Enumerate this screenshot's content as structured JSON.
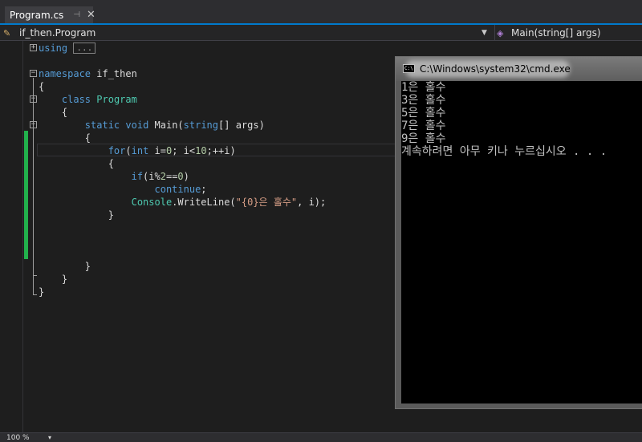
{
  "tab": {
    "title": "Program.cs",
    "pin_glyph": "⊣",
    "close_glyph": "✕"
  },
  "nav": {
    "left_label": "if_then.Program",
    "left_icon": "class-icon",
    "right_label": "Main(string[] args)",
    "right_icon": "method-icon"
  },
  "code": {
    "using_kw": "using",
    "using_collapsed": "...",
    "namespace_kw": "namespace",
    "namespace_name": " if_then",
    "class_kw": "class",
    "class_name": "Program",
    "static_kw": "static",
    "void_kw": "void",
    "main_name": " Main(",
    "string_kw": "string",
    "args_text": "[] args)",
    "for_kw": "for",
    "for_open": "(",
    "int_kw": "int",
    "for_init": " i=",
    "zero": "0",
    "for_cond": "; i<",
    "ten": "10",
    "for_inc": ";++i)",
    "if_kw": "if",
    "if_cond_pre": "(i%",
    "two": "2",
    "if_cond_mid": "==",
    "if_cond_zero": "0",
    "close_paren": ")",
    "continue_kw": "continue",
    "semicolon": ";",
    "console_type": "Console",
    "writeline_call": ".WriteLine(",
    "format_string": "\"{0}은 홀수\"",
    "writeline_args": ", i);",
    "open_brace": "{",
    "close_brace": "}"
  },
  "status": {
    "zoom": "100 %",
    "zoom_drop": "▾"
  },
  "cmd": {
    "title": "C:\\Windows\\system32\\cmd.exe",
    "icon_text": "C:\\",
    "output": [
      "1은 홀수",
      "3은 홀수",
      "5은 홀수",
      "7은 홀수",
      "9은 홀수"
    ],
    "prompt": "계속하려면 아무 키나 누르십시오 . . ."
  }
}
